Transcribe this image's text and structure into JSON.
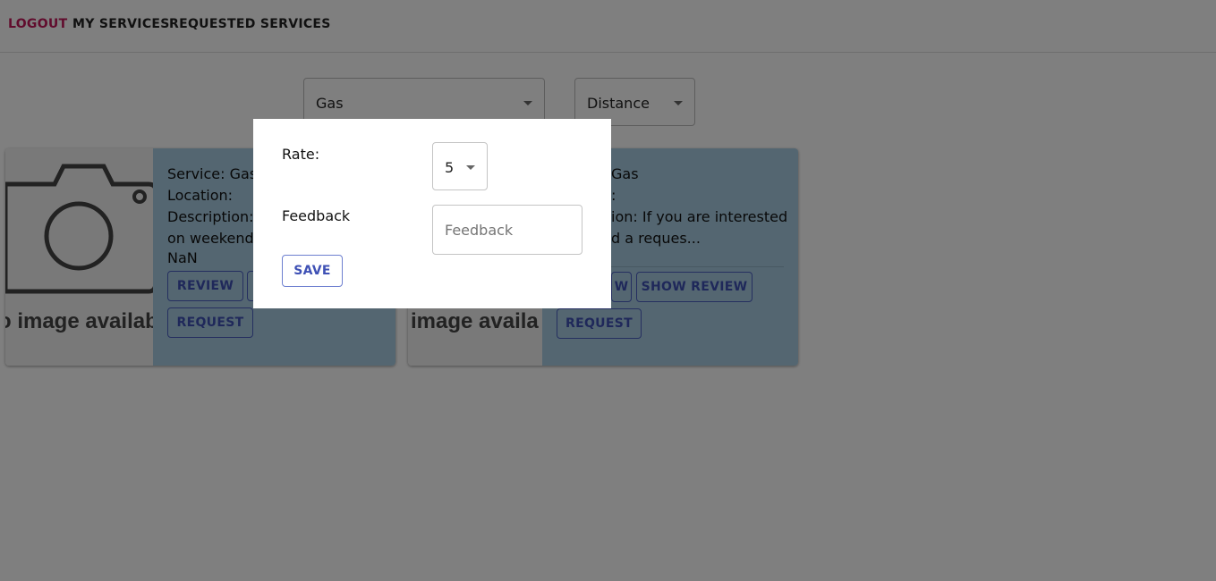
{
  "nav": {
    "logout": "LOGOUT",
    "my_services": "MY SERVICES",
    "requested_services": "REQUESTED SERVICES",
    "logout_color": "#c2185b"
  },
  "filters": {
    "service_value": "Gas",
    "sort_value": "Distance"
  },
  "cards": [
    {
      "no_image_text": "o image availab",
      "service": "Service: Gas",
      "location": "Location:",
      "description_1": "Description: I",
      "description_2": "on weekends",
      "distance": "NaN",
      "review_label": "REVIEW",
      "request_label": "REQUEST"
    },
    {
      "no_image_text": "image availa",
      "service_fragment": "Gas",
      "location_fragment": ":",
      "description_1": "ion: If you are interested",
      "description_2": "d a reques...",
      "review_fragment": "W",
      "show_review_label": "SHOW REVIEW",
      "request_label": "REQUEST"
    }
  ],
  "dialog": {
    "rate_label": "Rate:",
    "rate_value": "5",
    "feedback_label": "Feedback",
    "feedback_placeholder": "Feedback",
    "save_label": "SAVE"
  },
  "colors": {
    "card_body": "#a8cde3",
    "button_primary": "#3f51b5",
    "overlay": "rgba(0,0,0,0.5)"
  }
}
